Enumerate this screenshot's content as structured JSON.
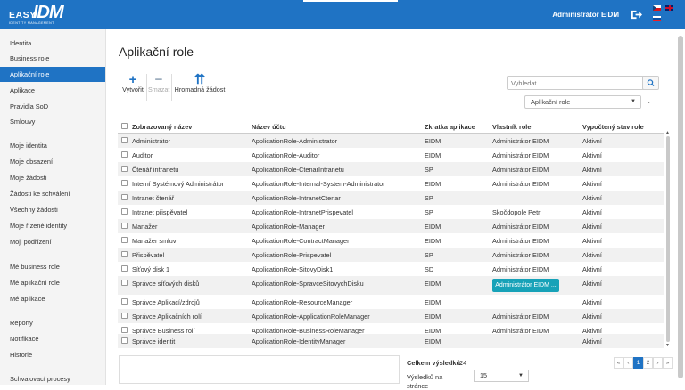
{
  "brand": {
    "easy": "EASY",
    "idm": "IDM",
    "sub": "IDENTITY MANAGEMENT"
  },
  "header": {
    "user": "Administrátor EIDM"
  },
  "sidebar": {
    "items": [
      {
        "label": "Identita",
        "active": false
      },
      {
        "label": "Business role",
        "active": false
      },
      {
        "label": "Aplikační role",
        "active": true
      },
      {
        "label": "Aplikace",
        "active": false
      },
      {
        "label": "Pravidla SoD",
        "active": false
      },
      {
        "label": "Smlouvy",
        "active": false
      },
      {
        "label": "Moje identita",
        "active": false
      },
      {
        "label": "Moje obsazení",
        "active": false
      },
      {
        "label": "Moje žádosti",
        "active": false
      },
      {
        "label": "Žádosti ke schválení",
        "active": false
      },
      {
        "label": "Všechny žádosti",
        "active": false
      },
      {
        "label": "Moje řízené identity",
        "active": false
      },
      {
        "label": "Moji podřízení",
        "active": false
      },
      {
        "label": "Mé business role",
        "active": false
      },
      {
        "label": "Mé aplikační role",
        "active": false
      },
      {
        "label": "Mé aplikace",
        "active": false
      },
      {
        "label": "Reporty",
        "active": false
      },
      {
        "label": "Notifikace",
        "active": false
      },
      {
        "label": "Historie",
        "active": false
      },
      {
        "label": "Schvalovací procesy",
        "active": false
      }
    ]
  },
  "page": {
    "title": "Aplikační role"
  },
  "toolbar": {
    "create_label": "Vytvořit",
    "delete_label": "Smazat",
    "bulk_label": "Hromadná žádost",
    "create_icon": "plus-icon",
    "delete_icon": "minus-icon",
    "bulk_icon": "double-arrow-up-icon"
  },
  "search": {
    "placeholder": "Vyhledat"
  },
  "filter": {
    "selected": "Aplikační role"
  },
  "table": {
    "columns": [
      "Zobrazovaný název",
      "Název účtu",
      "Zkratka aplikace",
      "Vlastník role",
      "Vypočtený stav role"
    ],
    "rows": [
      {
        "name": "Administrátor",
        "account": "ApplicationRole-Administrator",
        "app": "EIDM",
        "owner": "Administrátor EIDM",
        "state": "Aktivní"
      },
      {
        "name": "Auditor",
        "account": "ApplicationRole-Auditor",
        "app": "EIDM",
        "owner": "Administrátor EIDM",
        "state": "Aktivní"
      },
      {
        "name": "Čtenář intranetu",
        "account": "ApplicationRole-CtenarIntranetu",
        "app": "SP",
        "owner": "Administrátor EIDM",
        "state": "Aktivní"
      },
      {
        "name": "Interní Systémový Administrátor",
        "account": "ApplicationRole-Internal-System-Administrator",
        "app": "EIDM",
        "owner": "Administrátor EIDM",
        "state": "Aktivní"
      },
      {
        "name": "Intranet čtenář",
        "account": "ApplicationRole-IntranetCtenar",
        "app": "SP",
        "owner": "",
        "state": "Aktivní"
      },
      {
        "name": "Intranet přispěvatel",
        "account": "ApplicationRole-IntranetPrispevatel",
        "app": "SP",
        "owner": "Skočdopole Petr",
        "state": "Aktivní"
      },
      {
        "name": "Manažer",
        "account": "ApplicationRole-Manager",
        "app": "EIDM",
        "owner": "Administrátor EIDM",
        "state": "Aktivní"
      },
      {
        "name": "Manažer smluv",
        "account": "ApplicationRole-ContractManager",
        "app": "EIDM",
        "owner": "Administrátor EIDM",
        "state": "Aktivní"
      },
      {
        "name": "Přispěvatel",
        "account": "ApplicationRole-Prispevatel",
        "app": "SP",
        "owner": "Administrátor EIDM",
        "state": "Aktivní"
      },
      {
        "name": "Síťový disk 1",
        "account": "ApplicationRole-SitovyDisk1",
        "app": "SD",
        "owner": "Administrátor EIDM",
        "state": "Aktivní"
      },
      {
        "name": "Správce síťových disků",
        "account": "ApplicationRole-SpravceSitovychDisku",
        "app": "EIDM",
        "owner": "Administrátor EIDM ...",
        "state": "Aktivní"
      },
      {
        "name": "Správce Aplikací/zdrojů",
        "account": "ApplicationRole-ResourceManager",
        "app": "EIDM",
        "owner": "",
        "state": "Aktivní"
      },
      {
        "name": "Správce Aplikačních rolí",
        "account": "ApplicationRole-ApplicationRoleManager",
        "app": "EIDM",
        "owner": "Administrátor EIDM",
        "state": "Aktivní"
      },
      {
        "name": "Správce Business rolí",
        "account": "ApplicationRole-BusinessRoleManager",
        "app": "EIDM",
        "owner": "Administrátor EIDM",
        "state": "Aktivní"
      },
      {
        "name": "Správce identit",
        "account": "ApplicationRole-IdentityManager",
        "app": "EIDM",
        "owner": "",
        "state": "Aktivní"
      }
    ]
  },
  "footer": {
    "total_label": "Celkem výsledků:",
    "total_value": "24",
    "perpage_label_1": "Výsledků na",
    "perpage_label_2": "stránce",
    "perpage_value": "15"
  },
  "pager": {
    "first": "«",
    "prev": "‹",
    "pages": [
      "1",
      "2"
    ],
    "next": "›",
    "last": "»"
  },
  "colors": {
    "brand": "#1f73c4",
    "owner_button": "#17a2b8"
  }
}
